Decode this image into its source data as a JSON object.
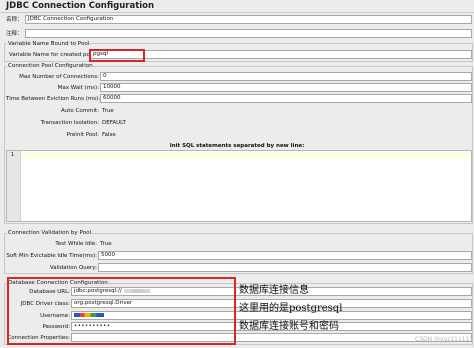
{
  "title": "JDBC Connection Configuration",
  "name_label": "名称：",
  "name_value": "JDBC Connection Configuration",
  "comments_label": "注释：",
  "variable_section": {
    "title": "Variable Name Bound to Pool",
    "variable_label": "Variable Name for created pool:",
    "variable_value": "pgsql"
  },
  "pool_section": {
    "title": "Connection Pool Configuration",
    "rows": [
      {
        "label": "Max Number of Connections:",
        "value": "0",
        "editable": true
      },
      {
        "label": "Max Wait (ms):",
        "value": "10000",
        "editable": true
      },
      {
        "label": "Time Between Eviction Runs (ms):",
        "value": "60000",
        "editable": true
      },
      {
        "label": "Auto Commit:",
        "value": "True",
        "editable": false
      },
      {
        "label": "Transaction Isolation:",
        "value": "DEFAULT",
        "editable": false
      },
      {
        "label": "Preinit Pool:",
        "value": "False",
        "editable": false
      }
    ],
    "init_sql_label": "Init SQL statements separated by new line:",
    "line_number": "1"
  },
  "validation_section": {
    "title": "Connection Validation by Pool",
    "rows": [
      {
        "label": "Test While Idle:",
        "value": "True",
        "editable": false
      },
      {
        "label": "Soft Min Evictable Idle Time(ms):",
        "value": "5000",
        "editable": true
      },
      {
        "label": "Validation Query:",
        "value": "",
        "editable": true
      }
    ]
  },
  "db_section": {
    "title": "Database Connection Configuration",
    "database_url_label": "Database URL:",
    "database_url_value": "jdbc:postgresql://",
    "driver_label": "JDBC Driver class:",
    "driver_value": "org.postgresql.Driver",
    "username_label": "Username:",
    "password_label": "Password:",
    "password_value": "••••••••••",
    "properties_label": "Connection Properties:"
  },
  "annotations": {
    "db_info": "数据库连接信息",
    "pg_used": "这里用的是postgresql",
    "account_pwd": "数据库连接账号和密码"
  },
  "watermark": "CSDN @yyz111111",
  "colors": {
    "annotation_red": "#d9262a",
    "background": "#ececec",
    "sql_line_highlight": "#fdfde0"
  }
}
